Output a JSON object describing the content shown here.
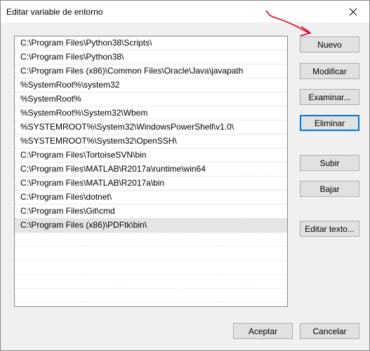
{
  "window": {
    "title": "Editar variable de entorno",
    "close_glyph": "✕"
  },
  "paths": [
    "C:\\Program Files\\Python38\\Scripts\\",
    "C:\\Program Files\\Python38\\",
    "C:\\Program Files (x86)\\Common Files\\Oracle\\Java\\javapath",
    "%SystemRoot%\\system32",
    "%SystemRoot%",
    "%SystemRoot%\\System32\\Wbem",
    "%SYSTEMROOT%\\System32\\WindowsPowerShell\\v1.0\\",
    "%SYSTEMROOT%\\System32\\OpenSSH\\",
    "C:\\Program Files\\TortoiseSVN\\bin",
    "C:\\Program Files\\MATLAB\\R2017a\\runtime\\win64",
    "C:\\Program Files\\MATLAB\\R2017a\\bin",
    "C:\\Program Files\\dotnet\\",
    "C:\\Program Files\\Git\\cmd",
    "C:\\Program Files (x86)\\PDFtk\\bin\\"
  ],
  "selected_index": 13,
  "buttons": {
    "nuevo": "Nuevo",
    "modificar": "Modificar",
    "examinar": "Examinar...",
    "eliminar": "Eliminar",
    "subir": "Subir",
    "bajar": "Bajar",
    "editar_texto": "Editar texto...",
    "aceptar": "Aceptar",
    "cancelar": "Cancelar"
  },
  "colors": {
    "focus_accent": "#0078d7",
    "annotation_arrow": "#e0001b",
    "selected_row": "#e5e5e5"
  },
  "icons": {
    "close": "close-icon",
    "annotation": "red-arrow-annotation"
  }
}
